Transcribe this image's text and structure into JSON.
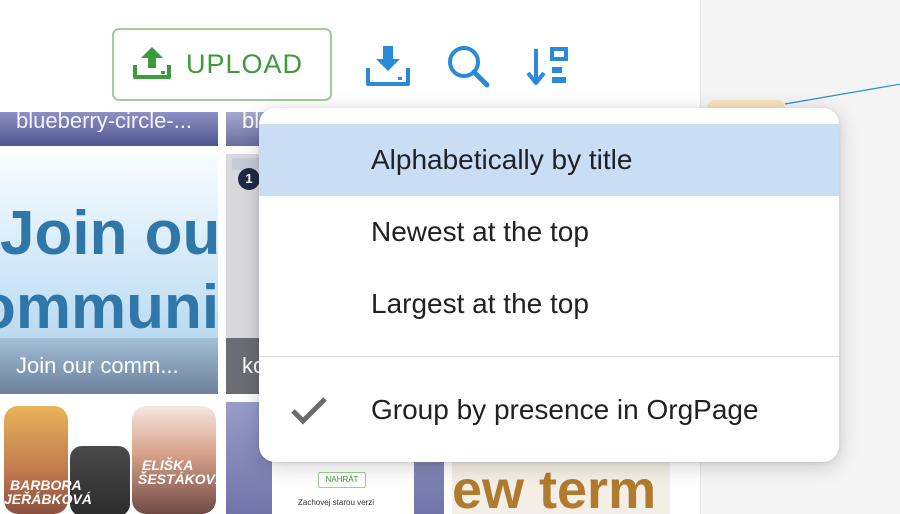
{
  "toolbar": {
    "upload_label": "UPLOAD",
    "upload_icon": "cloud-upload-icon",
    "download_icon": "download-icon",
    "search_icon": "search-icon",
    "sort_icon": "sort-icon",
    "accent_green": "#3e9b3c",
    "accent_blue": "#2b8ad8"
  },
  "thumbnails": [
    {
      "caption": "blueberry-circle-..."
    },
    {
      "caption": "bl"
    },
    {
      "hero_line1": "Join our",
      "hero_line2": "ommunit",
      "caption": "Join our comm..."
    },
    {
      "badge": "1",
      "caption": "ko"
    },
    {
      "name1_a": "BARBORA",
      "name1_b": "JEŘÁBKOVÁ",
      "name2_a": "ELIŠKA",
      "name2_b": "ŠESTÁKOVÁ"
    },
    {
      "button": "NAHRÁT",
      "checkbox": "Zachovej starou verzi"
    },
    {
      "text": "ew term"
    }
  ],
  "sort_menu": {
    "items": [
      {
        "label": "Alphabetically by title",
        "selected": true
      },
      {
        "label": "Newest at the top",
        "selected": false
      },
      {
        "label": "Largest at the top",
        "selected": false
      }
    ],
    "toggle": {
      "label": "Group by presence in OrgPage",
      "checked": true,
      "icon": "check-icon"
    },
    "highlight_color": "#c9def4"
  }
}
